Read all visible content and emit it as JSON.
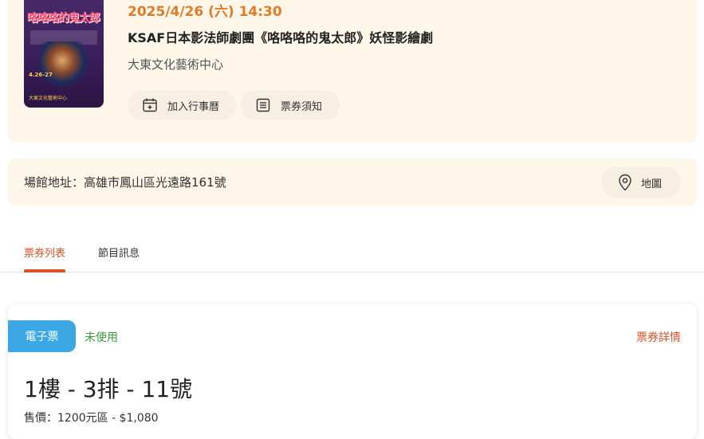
{
  "event": {
    "date": "2025/4/26 (六) 14:30",
    "title": "KSAF日本影法師劇團《咯咯咯的鬼太郎》妖怪影繪劇",
    "venue": "大東文化藝術中心",
    "poster": {
      "title": "咯咯咯的鬼太郎",
      "date": "4.26-27",
      "venue": "大東文化藝術中心"
    },
    "actions": [
      {
        "label": "加入行事曆",
        "icon": "calendar-add-icon"
      },
      {
        "label": "票券須知",
        "icon": "list-icon"
      }
    ]
  },
  "address": {
    "text": "場館地址：高雄市鳳山區光遠路161號",
    "map_label": "地圖",
    "map_icon": "map-pin-icon"
  },
  "tabs": [
    {
      "label": "票券列表",
      "active": true
    },
    {
      "label": "節目訊息",
      "active": false
    }
  ],
  "ticket": {
    "type_badge": "電子票",
    "status": "未使用",
    "detail_link": "票券詳情",
    "seat": "1樓 - 3排 - 11號",
    "price": "售價：1200元區 - $1,080"
  },
  "colors": {
    "accent": "#d2552b",
    "date": "#e07b2a",
    "card_bg": "#fdf6e9",
    "badge": "#3ba7e3",
    "status": "#3a9a3a"
  }
}
